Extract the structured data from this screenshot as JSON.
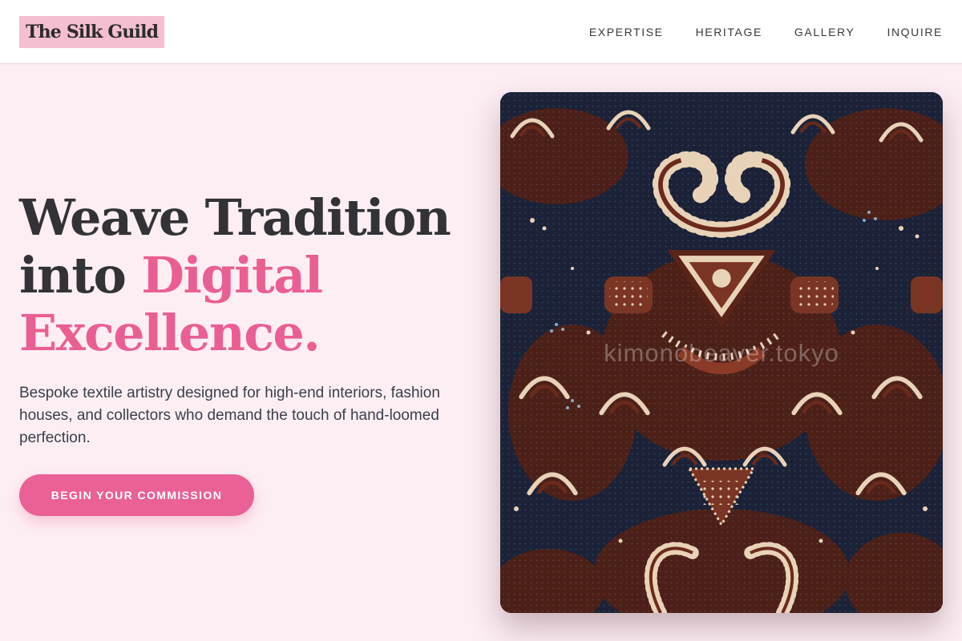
{
  "brand": {
    "name": "The Silk Guild"
  },
  "nav": {
    "items": [
      {
        "label": "EXPERTISE"
      },
      {
        "label": "HERITAGE"
      },
      {
        "label": "GALLERY"
      },
      {
        "label": "INQUIRE"
      }
    ]
  },
  "hero": {
    "headline_line1": "Weave Tradition",
    "headline_line2": "into ",
    "headline_accent": "Digital",
    "headline_line3": "Excellence.",
    "subtext": "Bespoke textile artistry designed for high-end interiors, fashion houses, and collectors who demand the touch of hand-loomed perfection.",
    "cta_label": "BEGIN YOUR COMMISSION",
    "image_watermark": "kimonobeaver.tokyo"
  },
  "colors": {
    "accent": "#ea6196",
    "background": "#fdeef3",
    "logo_bg": "#f4bfd0",
    "batik_dark": "#1b2237",
    "batik_brown": "#5a2418",
    "batik_cream": "#e9d3b8"
  }
}
